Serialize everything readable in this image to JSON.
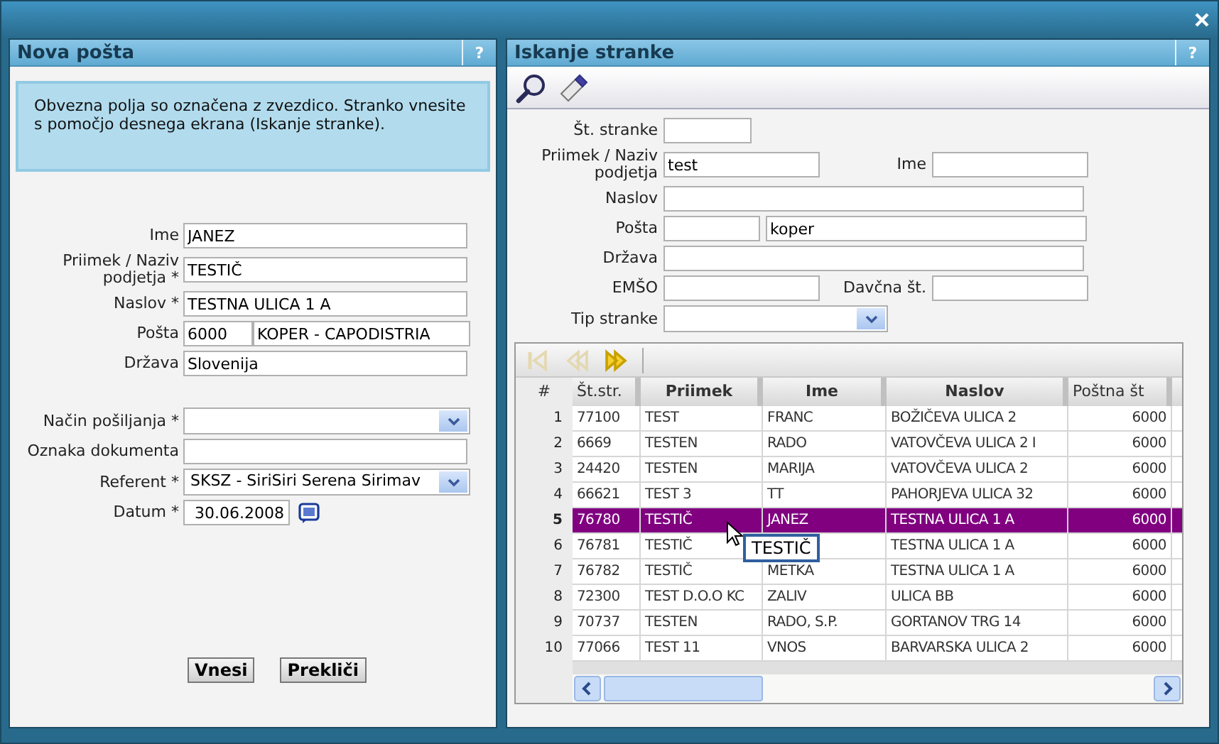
{
  "left_panel": {
    "title": "Nova pošta",
    "help": "?",
    "info": "Obvezna polja so označena z zvezdico. Stranko vnesite s pomočjo desnega ekrana (Iskanje stranke).",
    "fields": [
      {
        "kind": "text",
        "label": "Ime",
        "value": "JANEZ"
      },
      {
        "kind": "text",
        "label": "Priimek / Naziv podjetja *",
        "value": "TESTIČ"
      },
      {
        "kind": "text",
        "label": "Naslov *",
        "value": "TESTNA ULICA 1 A"
      },
      {
        "kind": "pair",
        "label": "Pošta",
        "value": "6000",
        "value2": "KOPER - CAPODISTRIA"
      },
      {
        "kind": "text",
        "label": "Država",
        "value": "Slovenija"
      },
      {
        "kind": "gap"
      },
      {
        "kind": "select",
        "label": "Način pošiljanja *"
      },
      {
        "kind": "text",
        "label": "Oznaka dokumenta"
      },
      {
        "kind": "select",
        "label": "Referent *",
        "value": "SKSZ - SiriSiri Serena Sirimav"
      },
      {
        "kind": "date",
        "label": "Datum *",
        "value": "30.06.2008"
      }
    ],
    "buttons": [
      "Vnesi",
      "Prekliči"
    ]
  },
  "right_panel": {
    "title": "Iskanje stranke",
    "help": "?",
    "search_rows": [
      {
        "kind": "short",
        "label": "Št. stranke"
      },
      {
        "kind": "two",
        "label": "Priimek / Naziv podjetja",
        "value": "test",
        "label2": "Ime"
      },
      {
        "kind": "wide",
        "label": "Naslov"
      },
      {
        "kind": "postal",
        "label": "Pošta",
        "value2": "koper"
      },
      {
        "kind": "wide",
        "label": "Država"
      },
      {
        "kind": "two",
        "label": "EMŠO",
        "label2": "Davčna št."
      },
      {
        "kind": "select",
        "label": "Tip stranke"
      }
    ],
    "pager": [
      {
        "kind": "first",
        "disabled": true
      },
      {
        "kind": "prev",
        "disabled": true
      },
      {
        "kind": "next",
        "disabled": false
      }
    ],
    "table": {
      "columns": [
        {
          "label": "#",
          "bold": false
        },
        {
          "label": "Št.str.",
          "bold": false
        },
        {
          "label": "Priimek",
          "bold": true
        },
        {
          "label": "Ime",
          "bold": true
        },
        {
          "label": "Naslov",
          "bold": true
        },
        {
          "label": "Poštna št",
          "bold": false
        }
      ],
      "rows": [
        {
          "n": "1",
          "st": "77100",
          "priimek": "TEST",
          "ime": "FRANC",
          "naslov": "BOŽIČEVA ULICA 2",
          "postna": "6000",
          "selected": false
        },
        {
          "n": "2",
          "st": "6669",
          "priimek": "TESTEN",
          "ime": "RADO",
          "naslov": "VATOVČEVA ULICA 2 I",
          "postna": "6000",
          "selected": false
        },
        {
          "n": "3",
          "st": "24420",
          "priimek": "TESTEN",
          "ime": "MARIJA",
          "naslov": "VATOVČEVA ULICA 2",
          "postna": "6000",
          "selected": false
        },
        {
          "n": "4",
          "st": "66621",
          "priimek": "TEST 3",
          "ime": "TT",
          "naslov": "PAHORJEVA ULICA 32",
          "postna": "6000",
          "selected": false
        },
        {
          "n": "5",
          "st": "76780",
          "priimek": "TESTIČ",
          "ime": "JANEZ",
          "naslov": "TESTNA ULICA 1 A",
          "postna": "6000",
          "selected": true
        },
        {
          "n": "6",
          "st": "76781",
          "priimek": "TESTIČ",
          "naslov": "TESTNA ULICA 1 A",
          "postna": "6000",
          "selected": false
        },
        {
          "n": "7",
          "st": "76782",
          "priimek": "TESTIČ",
          "ime": "METKA",
          "naslov": "TESTNA ULICA 1 A",
          "postna": "6000",
          "selected": false
        },
        {
          "n": "8",
          "st": "72300",
          "priimek": "TEST D.O.O KC",
          "ime": "ZALIV",
          "naslov": "ULICA BB",
          "postna": "6000",
          "selected": false
        },
        {
          "n": "9",
          "st": "70737",
          "priimek": "TESTEN",
          "ime": "RADO, S.P.",
          "naslov": "GORTANOV TRG 14",
          "postna": "6000",
          "selected": false
        },
        {
          "n": "10",
          "st": "77066",
          "priimek": "TEST 11",
          "ime": "VNOS",
          "naslov": "BARVARSKA ULICA 2",
          "postna": "6000",
          "selected": false
        }
      ]
    },
    "tooltip": "TESTIČ"
  }
}
